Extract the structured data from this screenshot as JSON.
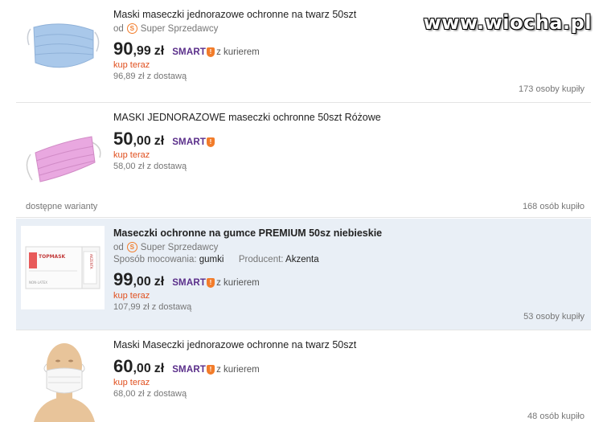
{
  "watermark": "www.wiocha.pl",
  "listings": [
    {
      "title": "Maski maseczki jednorazowe ochronne na twarz 50szt",
      "seller_prefix": "od",
      "seller_name": "Super Sprzedawcy",
      "price_int": "90",
      "price_dec": ",99",
      "currency": "zł",
      "smart_label": "SMART",
      "courier": "z kurierem",
      "buy_now": "kup teraz",
      "delivery": "96,89 zł z dostawą",
      "buyers": "173 osoby kupiły",
      "image_icon": "blue-surgical-mask"
    },
    {
      "title": "MASKI JEDNORAZOWE maseczki ochronne 50szt Różowe",
      "price_int": "50",
      "price_dec": ",00",
      "currency": "zł",
      "smart_label": "SMART",
      "buy_now": "kup teraz",
      "delivery": "58,00 zł z dostawą",
      "variants": "dostępne warianty",
      "buyers": "168 osób kupiło",
      "image_icon": "pink-surgical-mask"
    },
    {
      "title": "Maseczki ochronne na gumce PREMIUM 50sz niebieskie",
      "seller_prefix": "od",
      "seller_name": "Super Sprzedawcy",
      "attr1_label": "Sposób mocowania:",
      "attr1_value": "gumki",
      "attr2_label": "Producent:",
      "attr2_value": "Akzenta",
      "price_int": "99",
      "price_dec": ",00",
      "currency": "zł",
      "smart_label": "SMART",
      "courier": "z kurierem",
      "buy_now": "kup teraz",
      "delivery": "107,99 zł z dostawą",
      "buyers": "53 osoby kupiły",
      "image_icon": "mask-box",
      "box_brand": "TOPMASK",
      "box_side": "AKZENTA",
      "box_note": "NON-LATEX"
    },
    {
      "title": "Maski Maseczki jednorazowe ochronne na twarz 50szt",
      "price_int": "60",
      "price_dec": ",00",
      "currency": "zł",
      "smart_label": "SMART",
      "courier": "z kurierem",
      "buy_now": "kup teraz",
      "delivery": "68,00 zł z dostawą",
      "buyers": "48 osób kupiło",
      "image_icon": "mannequin-with-mask"
    }
  ],
  "colors": {
    "price_accent": "#e0501f",
    "smart": "#5a2e8a",
    "smart_badge": "#f27c2a",
    "highlight_row": "#e9eff6"
  }
}
